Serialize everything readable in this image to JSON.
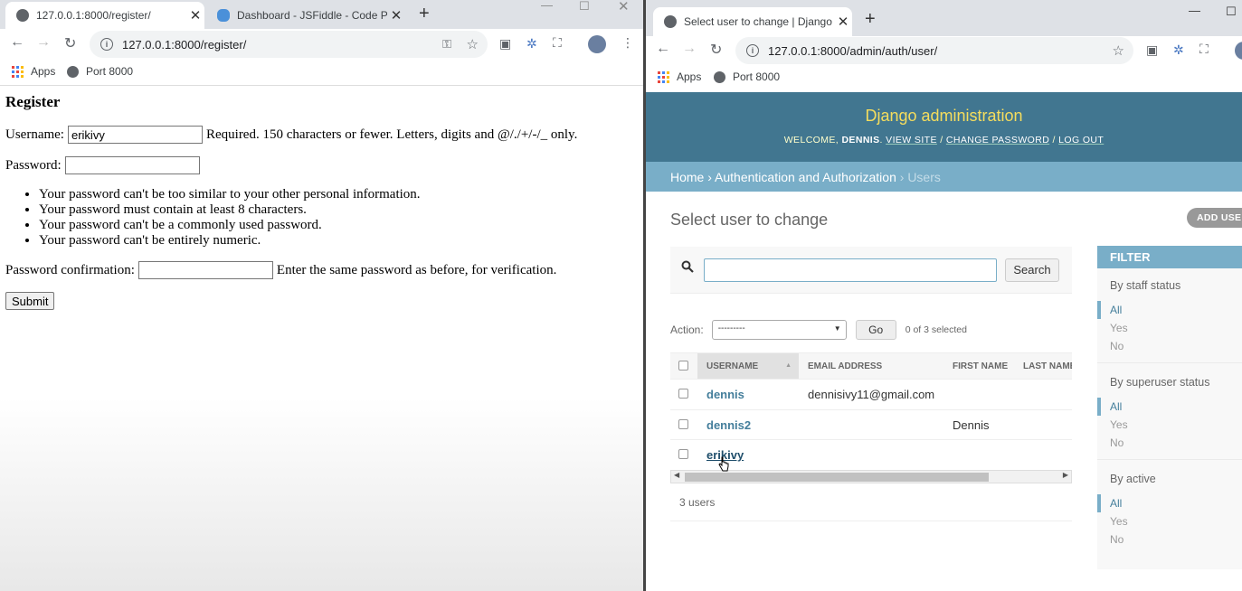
{
  "left_window": {
    "tabs": [
      {
        "title": "127.0.0.1:8000/register/",
        "active": true
      },
      {
        "title": "Dashboard - JSFiddle - Code Play",
        "active": false
      }
    ],
    "url": "127.0.0.1:8000/register/",
    "bookmarks": [
      {
        "label": "Apps"
      },
      {
        "label": "Port 8000"
      }
    ],
    "page": {
      "heading": "Register",
      "username_label": "Username:",
      "username_value": "erikivy",
      "username_help": "Required. 150 characters or fewer. Letters, digits and @/./+/-/_ only.",
      "password_label": "Password:",
      "password_rules": [
        "Your password can't be too similar to your other personal information.",
        "Your password must contain at least 8 characters.",
        "Your password can't be a commonly used password.",
        "Your password can't be entirely numeric."
      ],
      "confirm_label": "Password confirmation:",
      "confirm_help": "Enter the same password as before, for verification.",
      "submit_label": "Submit"
    }
  },
  "right_window": {
    "tabs": [
      {
        "title": "Select user to change | Django si",
        "active": true
      }
    ],
    "url": "127.0.0.1:8000/admin/auth/user/",
    "bookmarks": [
      {
        "label": "Apps"
      },
      {
        "label": "Port 8000"
      }
    ],
    "admin": {
      "brand": "Django administration",
      "welcome": "WELCOME,",
      "user": "DENNIS",
      "view_site": "VIEW SITE",
      "change_password": "CHANGE PASSWORD",
      "log_out": "LOG OUT",
      "sep": "/",
      "breadcrumbs": {
        "home": "Home",
        "app": "Authentication and Authorization",
        "current": "Users",
        "sep": "›"
      },
      "title": "Select user to change",
      "add_button": "ADD USER",
      "search_button": "Search",
      "action_label": "Action:",
      "action_selected": "---------",
      "go_label": "Go",
      "selected_count": "0 of 3 selected",
      "columns": [
        "USERNAME",
        "EMAIL ADDRESS",
        "FIRST NAME",
        "LAST NAME"
      ],
      "rows": [
        {
          "username": "dennis",
          "email": "dennisivy11@gmail.com",
          "first_name": ""
        },
        {
          "username": "dennis2",
          "email": "",
          "first_name": "Dennis"
        },
        {
          "username": "erikivy",
          "email": "",
          "first_name": ""
        }
      ],
      "paginator": "3 users",
      "filter": {
        "title": "FILTER",
        "groups": [
          {
            "title": "By staff status",
            "options": [
              "All",
              "Yes",
              "No"
            ]
          },
          {
            "title": "By superuser status",
            "options": [
              "All",
              "Yes",
              "No"
            ]
          },
          {
            "title": "By active",
            "options": [
              "All",
              "Yes",
              "No"
            ]
          }
        ]
      }
    }
  },
  "colors": {
    "django_header": "#417690",
    "breadcrumb": "#79aec8",
    "brand": "#f5dd5d",
    "link": "#447e9b"
  }
}
